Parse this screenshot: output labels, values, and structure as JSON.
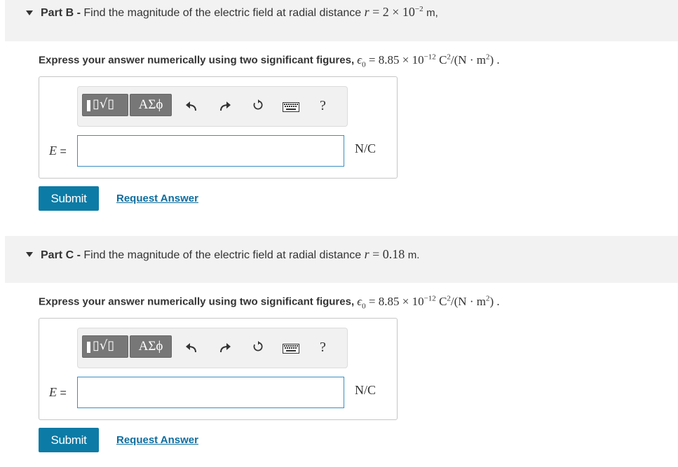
{
  "parts": [
    {
      "letter": "Part B",
      "sep": "-",
      "question": "Find the magnitude of the electric field at radial distance",
      "r_var": "r",
      "eq": "=",
      "r_value": "2 × 10",
      "r_exp": "−2",
      "r_unit": "m,",
      "instruction": "Express your answer numerically using two significant figures,",
      "constant": "ϵ",
      "constant_sub": "0",
      "constant_value": "= 8.85 × 10",
      "constant_exp": "−12",
      "constant_unit": "C",
      "constant_unit_exp": "2",
      "constant_unit_rest": "/(N · m",
      "constant_unit_exp2": "2",
      "constant_tail": ") .",
      "symbols_label": "ΑΣϕ",
      "help_label": "?",
      "var_label": "E",
      "var_eq": " =",
      "input_value": "",
      "unit": "N/C",
      "submit_label": "Submit",
      "request_label": "Request Answer"
    },
    {
      "letter": "Part C",
      "sep": "-",
      "question": "Find the magnitude of the electric field at radial distance",
      "r_var": "r",
      "eq": "=",
      "r_value": "0.18",
      "r_unit": "m.",
      "instruction": "Express your answer numerically using two significant figures,",
      "constant": "ϵ",
      "constant_sub": "0",
      "constant_value": "= 8.85 × 10",
      "constant_exp": "−12",
      "constant_unit": "C",
      "constant_unit_exp": "2",
      "constant_unit_rest": "/(N · m",
      "constant_unit_exp2": "2",
      "constant_tail": ") .",
      "symbols_label": "ΑΣϕ",
      "help_label": "?",
      "var_label": "E",
      "var_eq": " =",
      "input_value": "",
      "unit": "N/C",
      "submit_label": "Submit",
      "request_label": "Request Answer"
    }
  ],
  "icons": {
    "collapse": "caret-down-icon",
    "templates": "templates-icon",
    "symbols": "symbols-icon",
    "undo": "undo-icon",
    "redo": "redo-icon",
    "reset": "reset-icon",
    "keyboard": "keyboard-icon",
    "help": "help-icon"
  },
  "colors": {
    "submit": "#0c7ba5",
    "link": "#0d6d9e",
    "input_border": "#3b8ec2",
    "header_bg": "#f2f2f2"
  }
}
